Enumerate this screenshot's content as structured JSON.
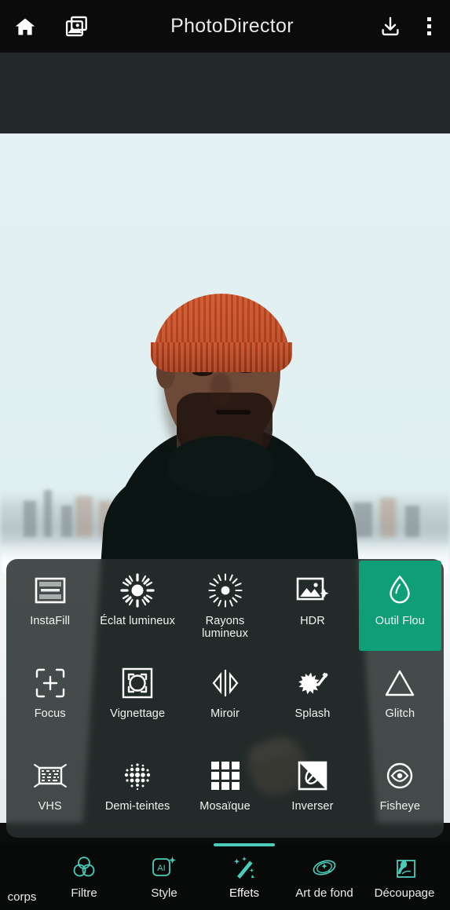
{
  "app": {
    "title": "PhotoDirector",
    "accent_selected": "#0e9e78",
    "accent_nav": "#4bccbb",
    "topbar_bg": "#0b0b0b",
    "panel_bg": "rgba(40,48,46,0.86)"
  },
  "topbar": {
    "home_icon": "home-icon",
    "gallery_icon": "gallery-icon",
    "title": "PhotoDirector",
    "download_icon": "download-icon",
    "more_icon": "more-vertical-icon"
  },
  "effects_panel": {
    "rows": [
      [
        {
          "label": "InstaFill",
          "icon": "instafill-icon",
          "selected": false
        },
        {
          "label": "Éclat lumineux",
          "icon": "light-burst-icon",
          "selected": false
        },
        {
          "label": "Rayons lumineux",
          "icon": "light-rays-icon",
          "selected": false
        },
        {
          "label": "HDR",
          "icon": "hdr-icon",
          "selected": false
        },
        {
          "label": "Outil Flou",
          "icon": "blur-droplet-icon",
          "selected": true
        }
      ],
      [
        {
          "label": "Focus",
          "icon": "focus-icon",
          "selected": false
        },
        {
          "label": "Vignettage",
          "icon": "vignette-icon",
          "selected": false
        },
        {
          "label": "Miroir",
          "icon": "mirror-icon",
          "selected": false
        },
        {
          "label": "Splash",
          "icon": "splash-icon",
          "selected": false
        },
        {
          "label": "Glitch",
          "icon": "glitch-triangle-icon",
          "selected": false
        }
      ],
      [
        {
          "label": "VHS",
          "icon": "vhs-icon",
          "selected": false
        },
        {
          "label": "Demi-teintes",
          "icon": "halftone-icon",
          "selected": false
        },
        {
          "label": "Mosaïque",
          "icon": "mosaic-icon",
          "selected": false
        },
        {
          "label": "Inverser",
          "icon": "invert-icon",
          "selected": false
        },
        {
          "label": "Fisheye",
          "icon": "fisheye-icon",
          "selected": false
        }
      ]
    ]
  },
  "bottom_nav": {
    "items": [
      {
        "label": "corps",
        "icon": "face-body-icon",
        "active": false,
        "partial": "left"
      },
      {
        "label": "Filtre",
        "icon": "filter-icon",
        "active": false,
        "partial": ""
      },
      {
        "label": "Style",
        "icon": "ai-style-icon",
        "active": false,
        "partial": ""
      },
      {
        "label": "Effets",
        "icon": "effects-wand-icon",
        "active": true,
        "partial": ""
      },
      {
        "label": "Art de fond",
        "icon": "background-art-icon",
        "active": false,
        "partial": ""
      },
      {
        "label": "Découpage",
        "icon": "cutout-icon",
        "active": false,
        "partial": ""
      }
    ]
  },
  "photo": {
    "description": "Portrait of a man wearing an orange knit beanie and black turtleneck, arms crossed, blurred city skyline background"
  }
}
